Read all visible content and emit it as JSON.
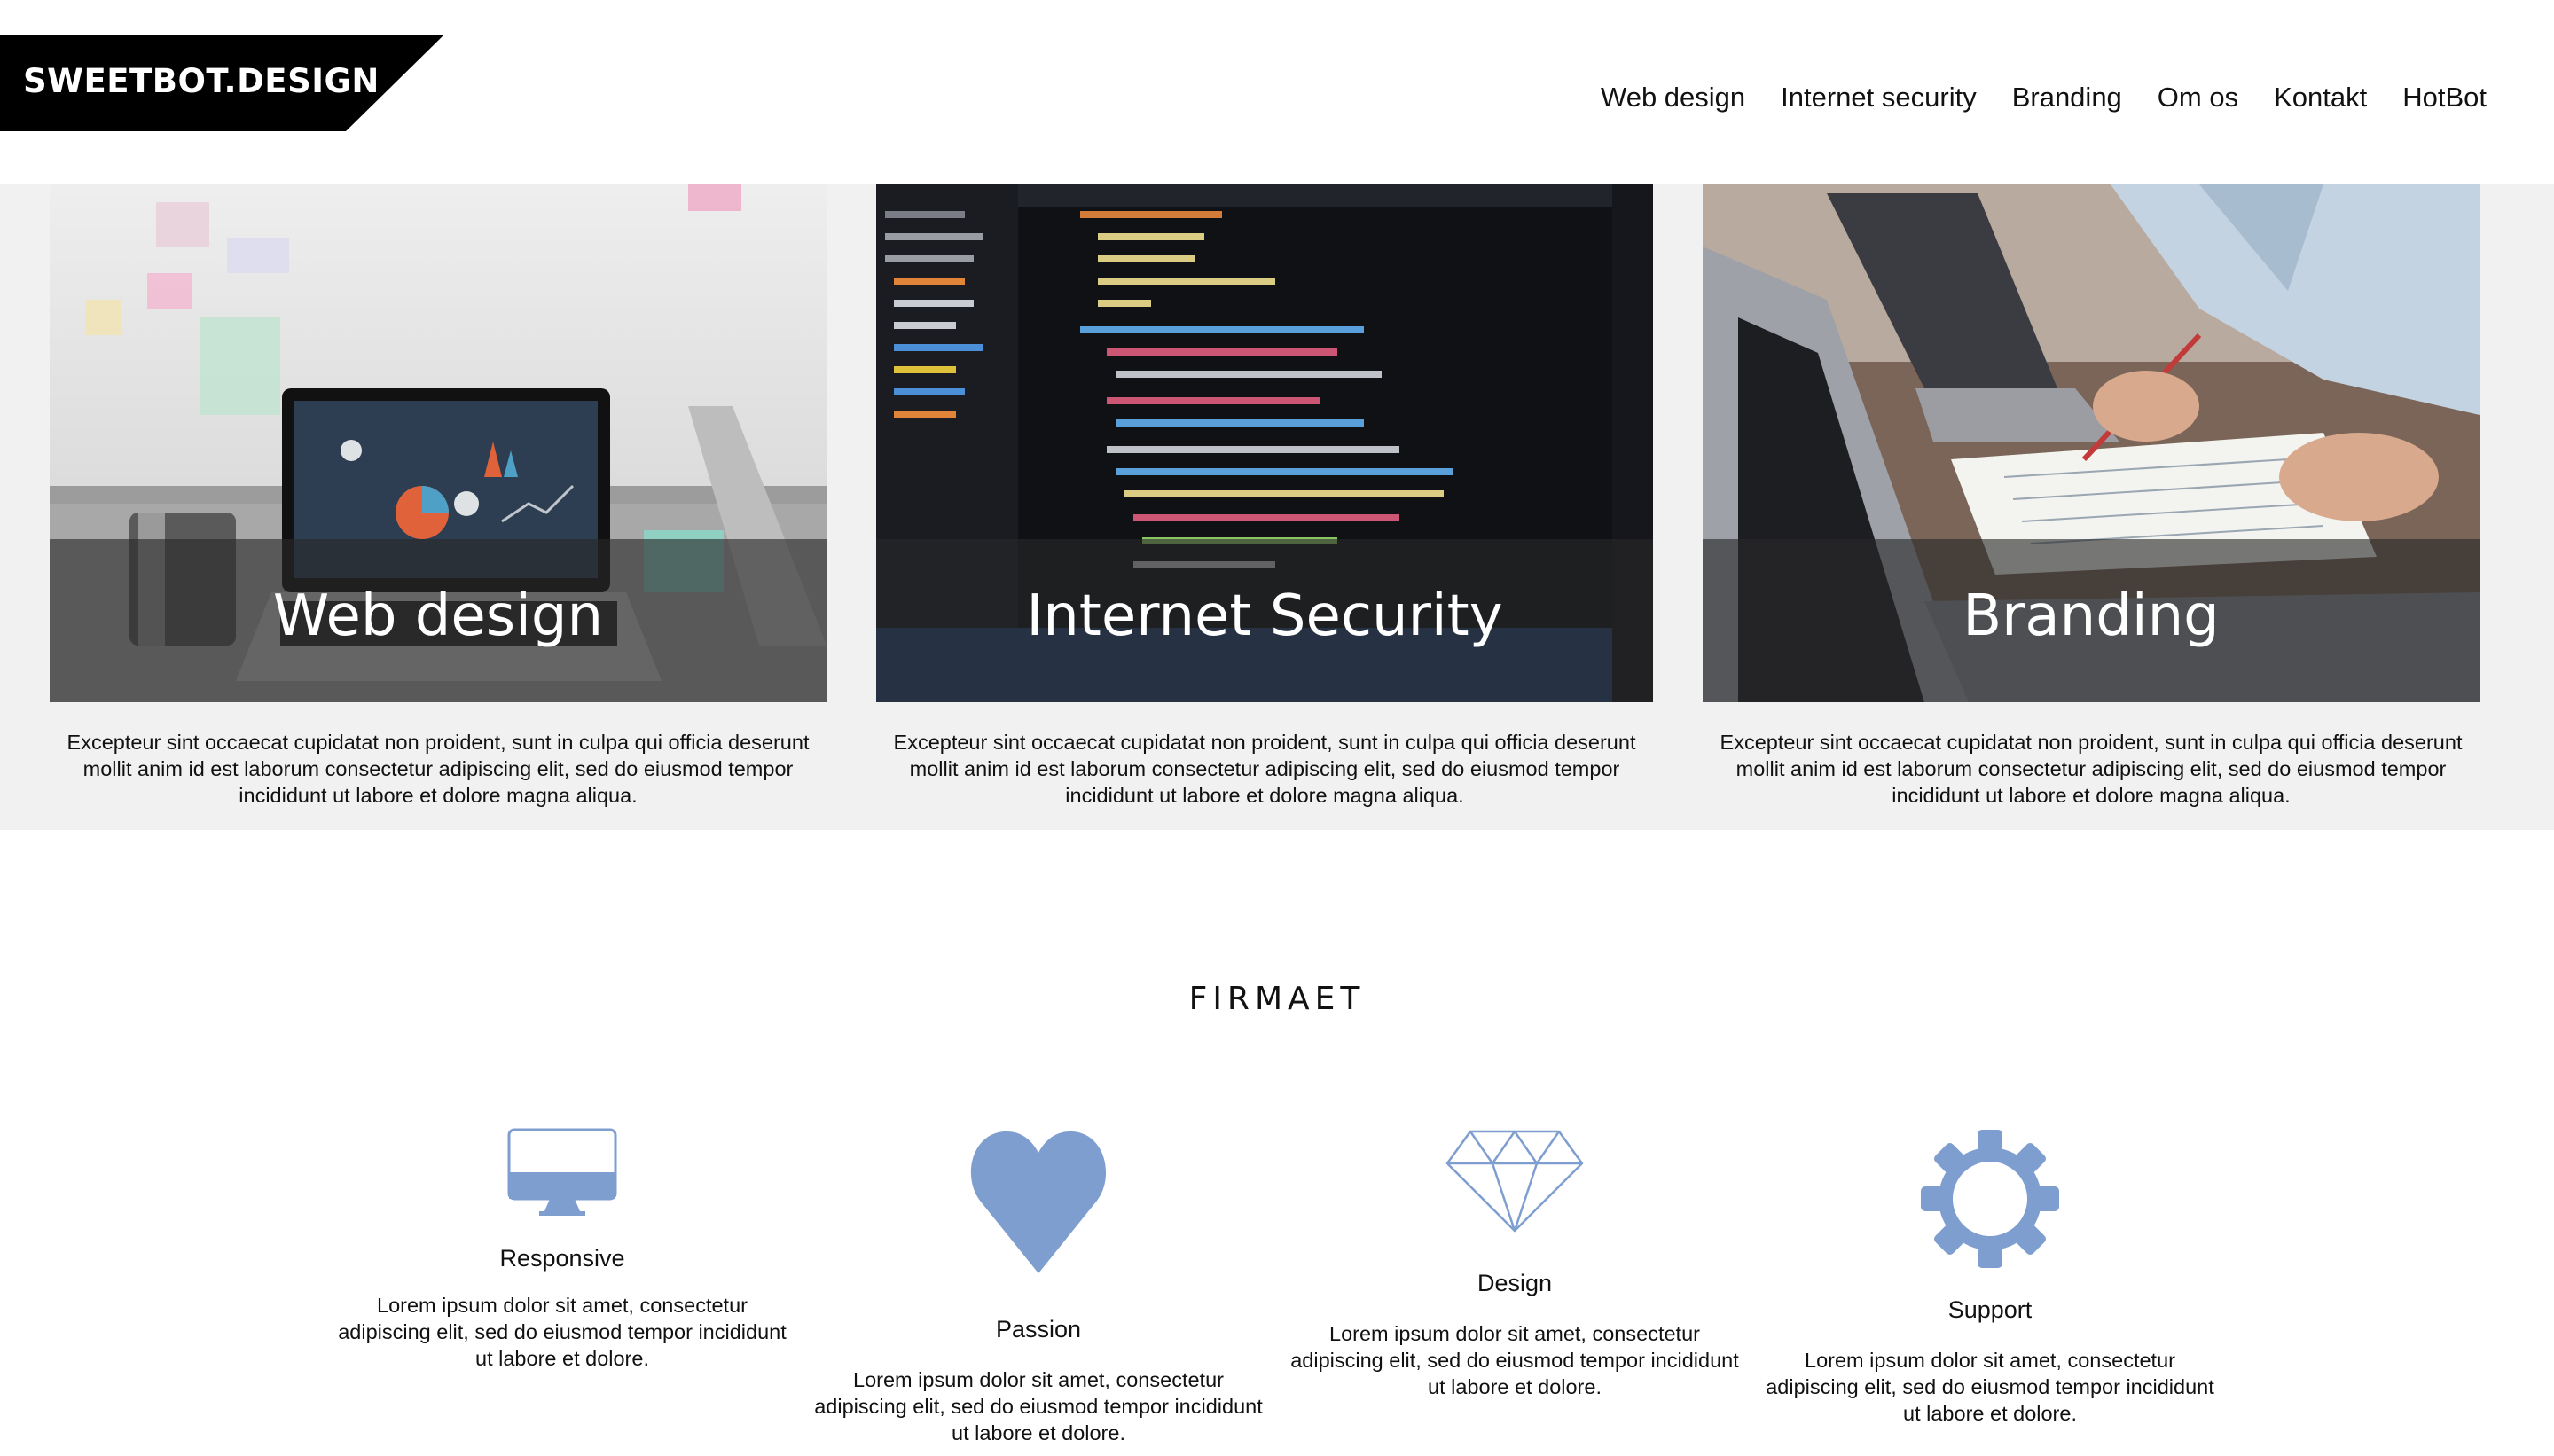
{
  "header": {
    "logo": "SWEETBOT.DESIGN",
    "nav": [
      "Web design",
      "Internet security",
      "Branding",
      "Om os",
      "Kontakt",
      "HotBot"
    ]
  },
  "services": [
    {
      "title": "Web design",
      "text": "Excepteur sint occaecat cupidatat non proident, sunt in culpa qui officia deserunt mollit anim id est laborum consectetur adipiscing elit, sed do eiusmod tempor incididunt ut labore et dolore magna aliqua."
    },
    {
      "title": "Internet Security",
      "text": "Excepteur sint occaecat cupidatat non proident, sunt in culpa qui officia deserunt mollit anim id est laborum consectetur adipiscing elit, sed do eiusmod tempor incididunt ut labore et dolore magna aliqua."
    },
    {
      "title": "Branding",
      "text": "Excepteur sint occaecat cupidatat non proident, sunt in culpa qui officia deserunt mollit anim id est laborum consectetur adipiscing elit, sed do eiusmod tempor incididunt ut labore et dolore magna aliqua."
    }
  ],
  "section": {
    "title": "FIRMAET"
  },
  "features": [
    {
      "name": "Responsive",
      "icon": "monitor-icon",
      "text": "Lorem ipsum dolor sit amet, consectetur adipiscing elit, sed do eiusmod tempor incididunt ut labore et dolore."
    },
    {
      "name": "Passion",
      "icon": "heart-icon",
      "text": "Lorem ipsum dolor sit amet, consectetur adipiscing elit, sed do eiusmod tempor incididunt ut labore et dolore."
    },
    {
      "name": "Design",
      "icon": "diamond-icon",
      "text": "Lorem ipsum dolor sit amet, consectetur adipiscing elit, sed do eiusmod tempor incididunt ut labore et dolore."
    },
    {
      "name": "Support",
      "icon": "gear-icon",
      "text": "Lorem ipsum dolor sit amet, consectetur adipiscing elit, sed do eiusmod tempor incididunt ut labore et dolore."
    }
  ],
  "colors": {
    "accent": "#7f9ed0",
    "band_bg": "#f1f1f1",
    "logo_bg": "#000000"
  }
}
